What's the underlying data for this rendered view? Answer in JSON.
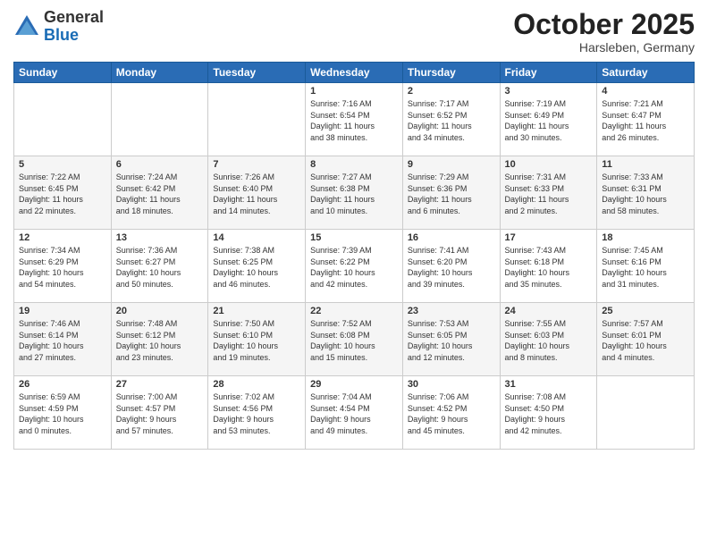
{
  "logo": {
    "general": "General",
    "blue": "Blue"
  },
  "title": "October 2025",
  "location": "Harsleben, Germany",
  "days_header": [
    "Sunday",
    "Monday",
    "Tuesday",
    "Wednesday",
    "Thursday",
    "Friday",
    "Saturday"
  ],
  "weeks": [
    [
      {
        "day": "",
        "content": ""
      },
      {
        "day": "",
        "content": ""
      },
      {
        "day": "",
        "content": ""
      },
      {
        "day": "1",
        "content": "Sunrise: 7:16 AM\nSunset: 6:54 PM\nDaylight: 11 hours\nand 38 minutes."
      },
      {
        "day": "2",
        "content": "Sunrise: 7:17 AM\nSunset: 6:52 PM\nDaylight: 11 hours\nand 34 minutes."
      },
      {
        "day": "3",
        "content": "Sunrise: 7:19 AM\nSunset: 6:49 PM\nDaylight: 11 hours\nand 30 minutes."
      },
      {
        "day": "4",
        "content": "Sunrise: 7:21 AM\nSunset: 6:47 PM\nDaylight: 11 hours\nand 26 minutes."
      }
    ],
    [
      {
        "day": "5",
        "content": "Sunrise: 7:22 AM\nSunset: 6:45 PM\nDaylight: 11 hours\nand 22 minutes."
      },
      {
        "day": "6",
        "content": "Sunrise: 7:24 AM\nSunset: 6:42 PM\nDaylight: 11 hours\nand 18 minutes."
      },
      {
        "day": "7",
        "content": "Sunrise: 7:26 AM\nSunset: 6:40 PM\nDaylight: 11 hours\nand 14 minutes."
      },
      {
        "day": "8",
        "content": "Sunrise: 7:27 AM\nSunset: 6:38 PM\nDaylight: 11 hours\nand 10 minutes."
      },
      {
        "day": "9",
        "content": "Sunrise: 7:29 AM\nSunset: 6:36 PM\nDaylight: 11 hours\nand 6 minutes."
      },
      {
        "day": "10",
        "content": "Sunrise: 7:31 AM\nSunset: 6:33 PM\nDaylight: 11 hours\nand 2 minutes."
      },
      {
        "day": "11",
        "content": "Sunrise: 7:33 AM\nSunset: 6:31 PM\nDaylight: 10 hours\nand 58 minutes."
      }
    ],
    [
      {
        "day": "12",
        "content": "Sunrise: 7:34 AM\nSunset: 6:29 PM\nDaylight: 10 hours\nand 54 minutes."
      },
      {
        "day": "13",
        "content": "Sunrise: 7:36 AM\nSunset: 6:27 PM\nDaylight: 10 hours\nand 50 minutes."
      },
      {
        "day": "14",
        "content": "Sunrise: 7:38 AM\nSunset: 6:25 PM\nDaylight: 10 hours\nand 46 minutes."
      },
      {
        "day": "15",
        "content": "Sunrise: 7:39 AM\nSunset: 6:22 PM\nDaylight: 10 hours\nand 42 minutes."
      },
      {
        "day": "16",
        "content": "Sunrise: 7:41 AM\nSunset: 6:20 PM\nDaylight: 10 hours\nand 39 minutes."
      },
      {
        "day": "17",
        "content": "Sunrise: 7:43 AM\nSunset: 6:18 PM\nDaylight: 10 hours\nand 35 minutes."
      },
      {
        "day": "18",
        "content": "Sunrise: 7:45 AM\nSunset: 6:16 PM\nDaylight: 10 hours\nand 31 minutes."
      }
    ],
    [
      {
        "day": "19",
        "content": "Sunrise: 7:46 AM\nSunset: 6:14 PM\nDaylight: 10 hours\nand 27 minutes."
      },
      {
        "day": "20",
        "content": "Sunrise: 7:48 AM\nSunset: 6:12 PM\nDaylight: 10 hours\nand 23 minutes."
      },
      {
        "day": "21",
        "content": "Sunrise: 7:50 AM\nSunset: 6:10 PM\nDaylight: 10 hours\nand 19 minutes."
      },
      {
        "day": "22",
        "content": "Sunrise: 7:52 AM\nSunset: 6:08 PM\nDaylight: 10 hours\nand 15 minutes."
      },
      {
        "day": "23",
        "content": "Sunrise: 7:53 AM\nSunset: 6:05 PM\nDaylight: 10 hours\nand 12 minutes."
      },
      {
        "day": "24",
        "content": "Sunrise: 7:55 AM\nSunset: 6:03 PM\nDaylight: 10 hours\nand 8 minutes."
      },
      {
        "day": "25",
        "content": "Sunrise: 7:57 AM\nSunset: 6:01 PM\nDaylight: 10 hours\nand 4 minutes."
      }
    ],
    [
      {
        "day": "26",
        "content": "Sunrise: 6:59 AM\nSunset: 4:59 PM\nDaylight: 10 hours\nand 0 minutes."
      },
      {
        "day": "27",
        "content": "Sunrise: 7:00 AM\nSunset: 4:57 PM\nDaylight: 9 hours\nand 57 minutes."
      },
      {
        "day": "28",
        "content": "Sunrise: 7:02 AM\nSunset: 4:56 PM\nDaylight: 9 hours\nand 53 minutes."
      },
      {
        "day": "29",
        "content": "Sunrise: 7:04 AM\nSunset: 4:54 PM\nDaylight: 9 hours\nand 49 minutes."
      },
      {
        "day": "30",
        "content": "Sunrise: 7:06 AM\nSunset: 4:52 PM\nDaylight: 9 hours\nand 45 minutes."
      },
      {
        "day": "31",
        "content": "Sunrise: 7:08 AM\nSunset: 4:50 PM\nDaylight: 9 hours\nand 42 minutes."
      },
      {
        "day": "",
        "content": ""
      }
    ]
  ]
}
